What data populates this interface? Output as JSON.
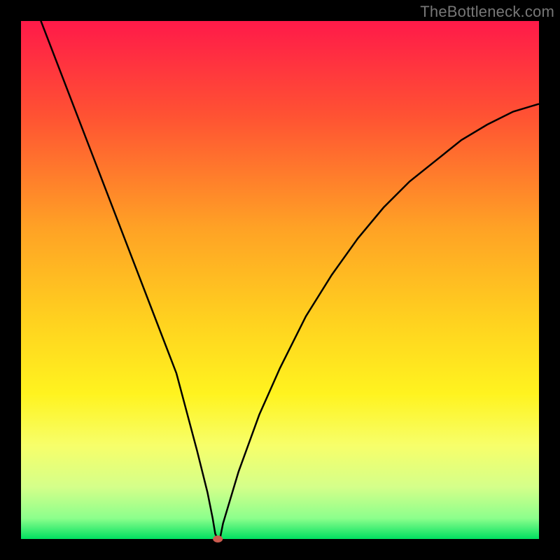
{
  "watermark": "TheBottleneck.com",
  "chart_data": {
    "type": "line",
    "title": "",
    "xlabel": "",
    "ylabel": "",
    "xlim": [
      0,
      100
    ],
    "ylim": [
      0,
      100
    ],
    "gradient_stops": [
      {
        "offset": 0.0,
        "color": "#ff1a49"
      },
      {
        "offset": 0.18,
        "color": "#ff5133"
      },
      {
        "offset": 0.4,
        "color": "#ffa225"
      },
      {
        "offset": 0.58,
        "color": "#ffd21f"
      },
      {
        "offset": 0.72,
        "color": "#fff31f"
      },
      {
        "offset": 0.82,
        "color": "#f7ff6a"
      },
      {
        "offset": 0.9,
        "color": "#d4ff8a"
      },
      {
        "offset": 0.96,
        "color": "#8cff8c"
      },
      {
        "offset": 1.0,
        "color": "#00e060"
      }
    ],
    "series": [
      {
        "name": "bottleneck-curve",
        "x": [
          0,
          5,
          10,
          15,
          20,
          25,
          30,
          34,
          36,
          37,
          37.5,
          38,
          38.5,
          39,
          42,
          46,
          50,
          55,
          60,
          65,
          70,
          75,
          80,
          85,
          90,
          95,
          100
        ],
        "values": [
          110,
          97,
          84,
          71,
          58,
          45,
          32,
          17,
          9,
          4,
          1,
          0,
          0.5,
          3,
          13,
          24,
          33,
          43,
          51,
          58,
          64,
          69,
          73,
          77,
          80,
          82.5,
          84
        ]
      }
    ],
    "marker": {
      "x": 38,
      "y": 0,
      "color": "#cc5b4f"
    },
    "annotations": []
  }
}
